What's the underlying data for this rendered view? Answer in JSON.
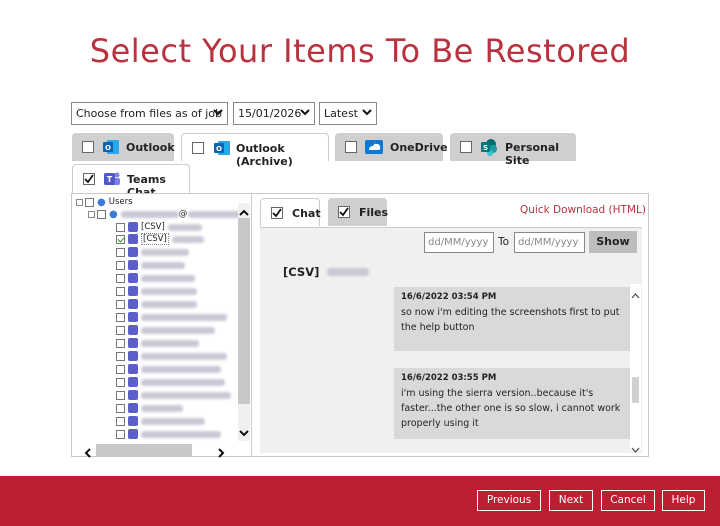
{
  "page_title": "Select Your Items To Be Restored",
  "filters": {
    "mode": "Choose from files as of job",
    "date": "15/01/2026",
    "version": "Latest"
  },
  "source_tabs": [
    {
      "label": "Outlook",
      "checked": false,
      "active": false
    },
    {
      "label": "Outlook (Archive)",
      "checked": false,
      "active": true
    },
    {
      "label": "OneDrive",
      "checked": false,
      "active": false
    },
    {
      "label": "Personal Site",
      "checked": false,
      "active": false
    },
    {
      "label": "Teams Chat",
      "checked": true,
      "active": true
    }
  ],
  "tree": {
    "root": "Users",
    "user_suffix": "@",
    "items": [
      {
        "label": "[CSV]",
        "checked": false
      },
      {
        "label": "[CSV]",
        "checked": true
      }
    ]
  },
  "content_tabs": {
    "chat": {
      "label": "Chat",
      "checked": true
    },
    "files": {
      "label": "Files",
      "checked": true
    }
  },
  "quick_download": "Quick Download (HTML)",
  "date_filter": {
    "from_placeholder": "dd/MM/yyyy",
    "to_label": "To",
    "to_placeholder": "dd/MM/yyyy",
    "show_label": "Show"
  },
  "chat": {
    "header": "[CSV]",
    "messages": [
      {
        "time": "16/6/2022 03:54 PM",
        "text": "so now i'm editing the screenshots first to put the help button"
      },
      {
        "time": "16/6/2022 03:55 PM",
        "text": "i'm using the sierra version..because it's faster...the other one is so slow, i cannot work properly using it"
      }
    ]
  },
  "buttons": {
    "previous": "Previous",
    "next": "Next",
    "cancel": "Cancel",
    "help": "Help"
  },
  "colors": {
    "brand_red": "#bc1e32",
    "title_red": "#b8323f",
    "teams_purple": "#5b5fc7",
    "outlook_blue": "#0a78d4"
  }
}
